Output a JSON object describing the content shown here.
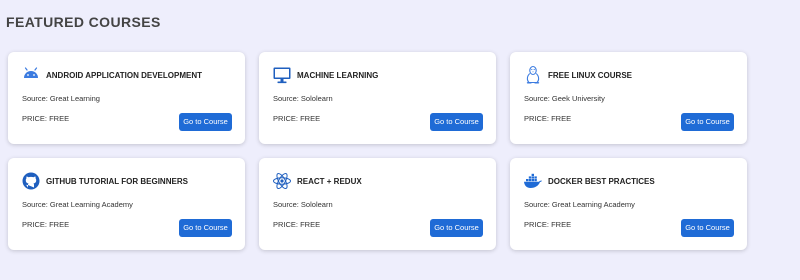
{
  "section": {
    "title": "FEATURED COURSES"
  },
  "courses": [
    {
      "title": "ANDROID APPLICATION DEVELOPMENT",
      "source": "Source: Great Learning",
      "price": "PRICE: FREE",
      "button_label": "Go to Course",
      "icon": "android-icon",
      "icon_color": "#3b7be0"
    },
    {
      "title": "MACHINE LEARNING",
      "source": "Source: Sololearn",
      "price": "PRICE: FREE",
      "button_label": "Go to Course",
      "icon": "desktop-icon",
      "icon_color": "#1f5fbf"
    },
    {
      "title": "FREE LINUX COURSE",
      "source": "Source: Geek University",
      "price": "PRICE: FREE",
      "button_label": "Go to Course",
      "icon": "linux-tux-icon",
      "icon_color": "#3b7be0"
    },
    {
      "title": "GITHUB TUTORIAL FOR BEGINNERS",
      "source": "Source: Great Learning Academy",
      "price": "PRICE: FREE",
      "button_label": "Go to Course",
      "icon": "github-icon",
      "icon_color": "#1f5fbf"
    },
    {
      "title": "REACT + REDUX",
      "source": "Source: Sololearn",
      "price": "PRICE: FREE",
      "button_label": "Go to Course",
      "icon": "react-icon",
      "icon_color": "#1f5fbf"
    },
    {
      "title": "DOCKER BEST PRACTICES",
      "source": "Source: Great Learning Academy",
      "price": "PRICE: FREE",
      "button_label": "Go to Course",
      "icon": "docker-icon",
      "icon_color": "#1f6bd6"
    }
  ],
  "colors": {
    "page_background": "#eeeefc",
    "card_background": "#ffffff",
    "button_background": "#1f6bd6",
    "button_text": "#ffffff"
  }
}
